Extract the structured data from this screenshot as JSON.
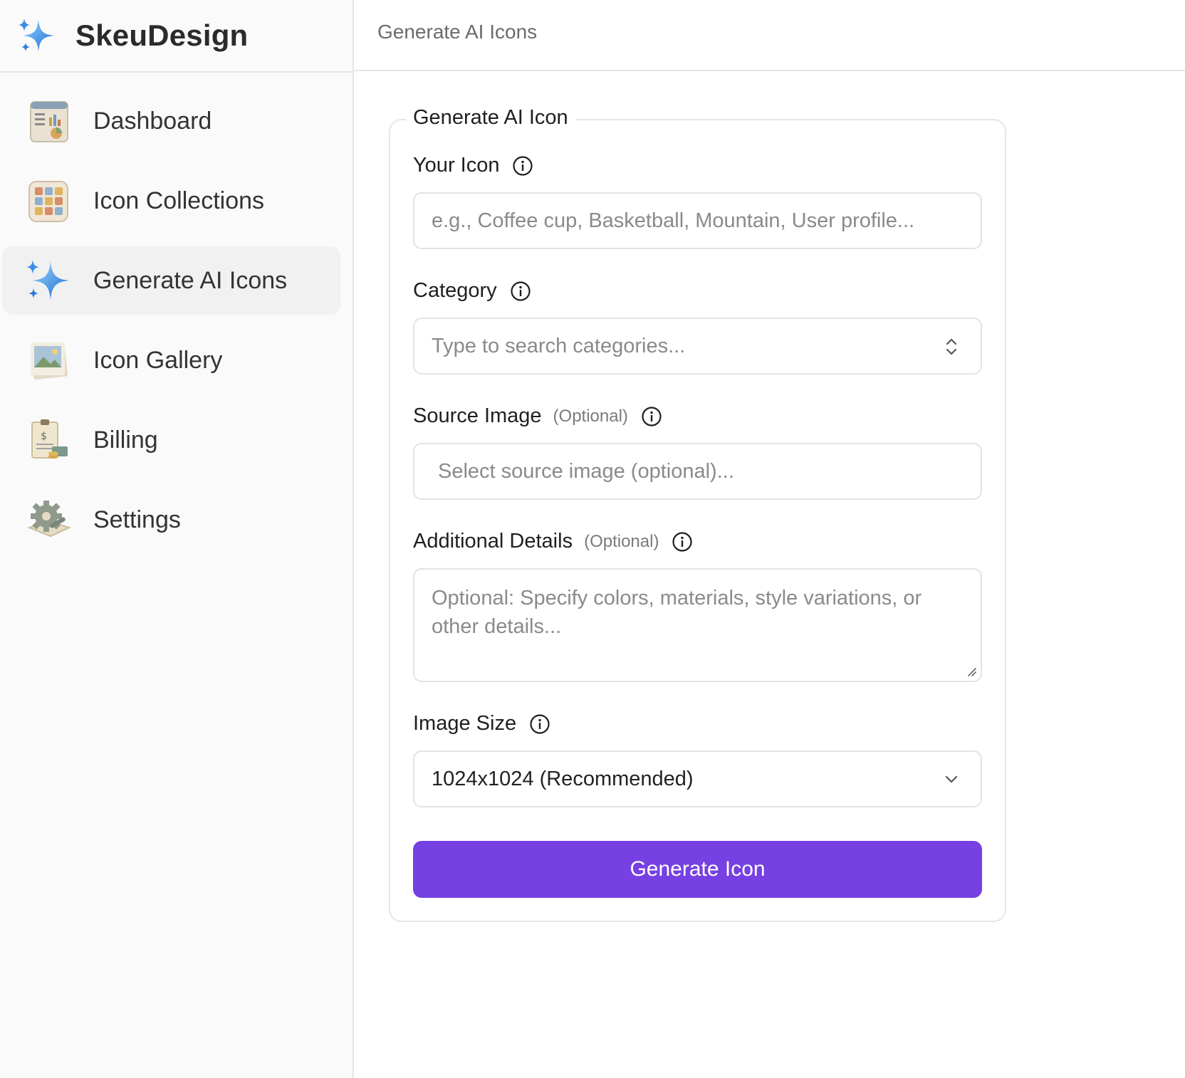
{
  "brand": {
    "name": "SkeuDesign",
    "icon": "sparkle-icon"
  },
  "sidebar": {
    "items": [
      {
        "label": "Dashboard",
        "icon": "dashboard-icon",
        "active": false
      },
      {
        "label": "Icon Collections",
        "icon": "collections-icon",
        "active": false
      },
      {
        "label": "Generate AI Icons",
        "icon": "sparkle-icon",
        "active": true
      },
      {
        "label": "Icon Gallery",
        "icon": "gallery-icon",
        "active": false
      },
      {
        "label": "Billing",
        "icon": "billing-icon",
        "active": false
      },
      {
        "label": "Settings",
        "icon": "gear-icon",
        "active": false
      }
    ]
  },
  "header": {
    "breadcrumb": "Generate AI Icons"
  },
  "form": {
    "legend": "Generate AI Icon",
    "your_icon": {
      "label": "Your Icon",
      "value": "",
      "placeholder": "e.g., Coffee cup, Basketball, Mountain, User profile..."
    },
    "category": {
      "label": "Category",
      "value": "",
      "placeholder": "Type to search categories..."
    },
    "source_image": {
      "label": "Source Image",
      "optional": "(Optional)",
      "placeholder": "Select source image (optional)..."
    },
    "additional_details": {
      "label": "Additional Details",
      "optional": "(Optional)",
      "value": "",
      "placeholder": "Optional: Specify colors, materials, style variations, or other details..."
    },
    "image_size": {
      "label": "Image Size",
      "value": "1024x1024 (Recommended)"
    },
    "submit_label": "Generate Icon"
  },
  "colors": {
    "accent": "#7640e2",
    "active_nav_bg": "#f1f1f1",
    "border": "#e6e6e6"
  }
}
